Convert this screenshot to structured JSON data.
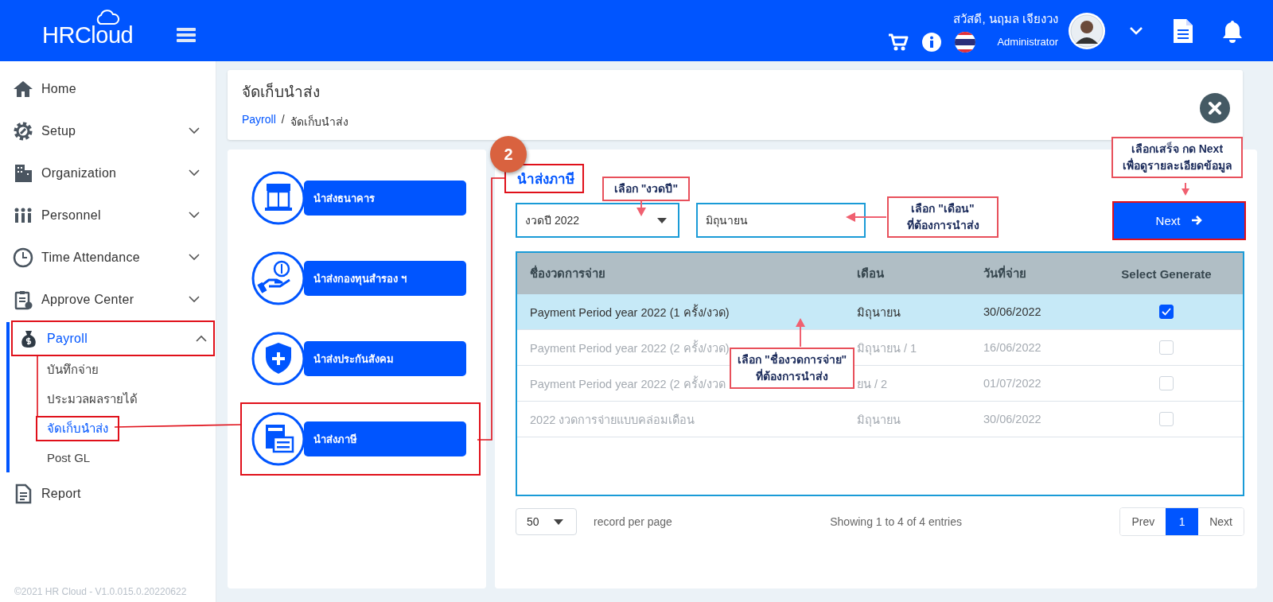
{
  "header": {
    "logo": "HRCloud",
    "greeting": "สวัสดี, นฤมล เจียงวง",
    "role": "Administrator"
  },
  "sidebar": {
    "items": [
      {
        "label": "Home",
        "kind": "link",
        "selected": false,
        "highlighted": false
      },
      {
        "label": "Setup",
        "kind": "group",
        "expanded": false,
        "selected": false,
        "highlighted": false
      },
      {
        "label": "Organization",
        "kind": "group",
        "expanded": false,
        "selected": false,
        "highlighted": false
      },
      {
        "label": "Personnel",
        "kind": "group",
        "expanded": false,
        "selected": false,
        "highlighted": false
      },
      {
        "label": "Time Attendance",
        "kind": "group",
        "expanded": false,
        "selected": false,
        "highlighted": false
      },
      {
        "label": "Approve Center",
        "kind": "group",
        "expanded": false,
        "selected": false,
        "highlighted": false
      },
      {
        "label": "Payroll",
        "kind": "group",
        "expanded": true,
        "selected": true,
        "highlighted": true,
        "children": [
          {
            "label": "บันทึกจ่าย",
            "selected": false,
            "highlighted": false
          },
          {
            "label": "ประมวลผลรายได้",
            "selected": false,
            "highlighted": false
          },
          {
            "label": "จัดเก็บนำส่ง",
            "selected": true,
            "highlighted": true
          },
          {
            "label": "Post GL",
            "selected": false,
            "highlighted": false
          }
        ]
      },
      {
        "label": "Report",
        "kind": "link",
        "selected": false,
        "highlighted": false
      }
    ],
    "footer": "©2021 HR Cloud - V1.0.015.0.20220622"
  },
  "page": {
    "title": "จัดเก็บนำส่ง",
    "breadcrumb": [
      "Payroll",
      "จัดเก็บนำส่ง"
    ],
    "separator": "/"
  },
  "remit_options": [
    {
      "label": "นำส่งธนาคาร",
      "highlighted": false
    },
    {
      "label": "นำส่งกองทุนสำรอง ฯ",
      "highlighted": false
    },
    {
      "label": "นำส่งประกันสังคม",
      "highlighted": false
    },
    {
      "label": "นำส่งภาษี",
      "highlighted": true
    }
  ],
  "panel": {
    "step": "2",
    "title": "นำส่งภาษี",
    "year_select": {
      "value": "งวดปี 2022"
    },
    "month_field": {
      "value": "มิถุนายน"
    },
    "next_button": {
      "label": "Next",
      "highlighted": true
    },
    "table": {
      "columns": [
        "ชื่องวดการจ่าย",
        "เดือน",
        "วันที่จ่าย",
        "Select Generate"
      ],
      "rows": [
        {
          "name": "Payment Period year 2022 (1 ครั้ง/งวด)",
          "month": "มิถุนายน",
          "pay_date": "30/06/2022",
          "selected": true,
          "checked": true,
          "disabled": false
        },
        {
          "name": "Payment Period year 2022 (2 ครั้ง/งวด)",
          "month": "มิถุนายน / 1",
          "pay_date": "16/06/2022",
          "selected": false,
          "checked": false,
          "disabled": true
        },
        {
          "name": "Payment Period year 2022 (2 ครั้ง/งวด",
          "month": "ยน / 2",
          "pay_date": "01/07/2022",
          "selected": false,
          "checked": false,
          "disabled": true
        },
        {
          "name": "2022 งวดการจ่ายแบบคล่อมเดือน",
          "month": "มิถุนายน",
          "pay_date": "30/06/2022",
          "selected": false,
          "checked": false,
          "disabled": true
        }
      ]
    },
    "page_size": "50",
    "page_size_label": "record per page",
    "summary": "Showing 1 to 4 of 4 entries",
    "pagination": [
      {
        "label": "Prev",
        "selected": false
      },
      {
        "label": "1",
        "selected": true
      },
      {
        "label": "Next",
        "selected": false
      }
    ]
  },
  "annotations": [
    {
      "lines": [
        "เลือก \"งวดปี\""
      ]
    },
    {
      "lines": [
        "เลือก \"เดือน\"",
        "ที่ต้องการนำส่ง"
      ]
    },
    {
      "lines": [
        "เลือกเสร็จ กด **Next**",
        "เพื่อดูรายละเอียดข้อมูล"
      ]
    },
    {
      "lines": [
        "เลือก \"ชื่องวดการจ่าย\"",
        "ที่ต้องการนำส่ง"
      ]
    }
  ]
}
